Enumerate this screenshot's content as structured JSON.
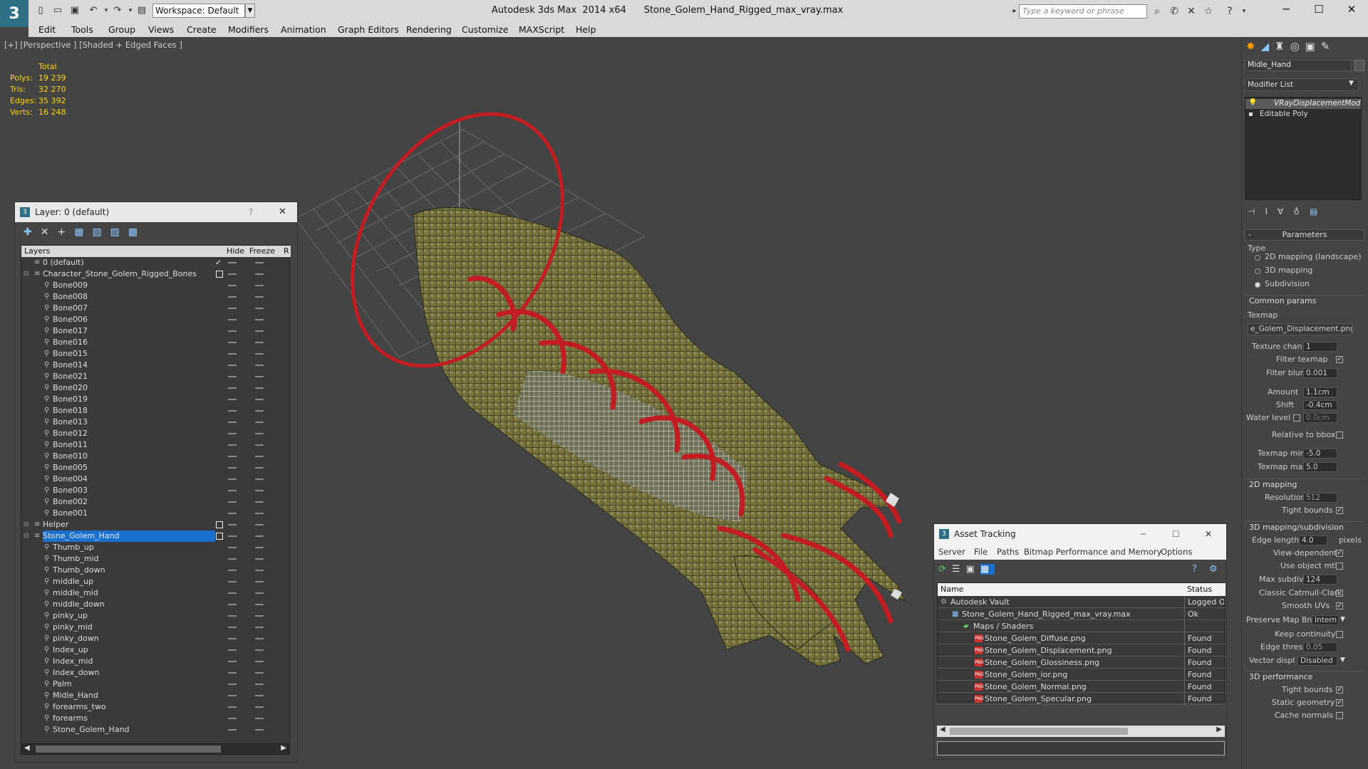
{
  "title_bar": {
    "app_title": "Autodesk 3ds Max  2014 x64",
    "file_name": "Stone_Golem_Hand_Rigged_max_vray.max",
    "workspace": "Workspace: Default",
    "search_placeholder": "Type a keyword or phrase"
  },
  "menu": [
    "Edit",
    "Tools",
    "Group",
    "Views",
    "Create",
    "Modifiers",
    "Animation",
    "Graph Editors",
    "Rendering",
    "Customize",
    "MAXScript",
    "Help"
  ],
  "viewport": {
    "label": "[+] [Perspective ] [Shaded + Edged Faces ]",
    "stats_header": "Total",
    "stats": [
      {
        "label": "Polys:",
        "value": "19 239"
      },
      {
        "label": "Tris:",
        "value": "32 270"
      },
      {
        "label": "Edges:",
        "value": "35 392"
      },
      {
        "label": "Verts:",
        "value": "16 248"
      }
    ]
  },
  "layer_panel": {
    "title": "Layer: 0 (default)",
    "help": "?",
    "close": "✕",
    "columns": {
      "layers": "Layers",
      "hide": "Hide",
      "freeze": "Freeze",
      "render": "R"
    },
    "rows": [
      {
        "name": "0 (default)",
        "level": 0,
        "kind": "layer"
      },
      {
        "name": "Character_Stone_Golem_Rigged_Bones",
        "level": 0,
        "kind": "layer"
      },
      {
        "name": "Bone009",
        "level": 1,
        "kind": "object"
      },
      {
        "name": "Bone008",
        "level": 1,
        "kind": "object"
      },
      {
        "name": "Bone007",
        "level": 1,
        "kind": "object"
      },
      {
        "name": "Bone006",
        "level": 1,
        "kind": "object"
      },
      {
        "name": "Bone017",
        "level": 1,
        "kind": "object"
      },
      {
        "name": "Bone016",
        "level": 1,
        "kind": "object"
      },
      {
        "name": "Bone015",
        "level": 1,
        "kind": "object"
      },
      {
        "name": "Bone014",
        "level": 1,
        "kind": "object"
      },
      {
        "name": "Bone021",
        "level": 1,
        "kind": "object"
      },
      {
        "name": "Bone020",
        "level": 1,
        "kind": "object"
      },
      {
        "name": "Bone019",
        "level": 1,
        "kind": "object"
      },
      {
        "name": "Bone018",
        "level": 1,
        "kind": "object"
      },
      {
        "name": "Bone013",
        "level": 1,
        "kind": "object"
      },
      {
        "name": "Bone012",
        "level": 1,
        "kind": "object"
      },
      {
        "name": "Bone011",
        "level": 1,
        "kind": "object"
      },
      {
        "name": "Bone010",
        "level": 1,
        "kind": "object"
      },
      {
        "name": "Bone005",
        "level": 1,
        "kind": "object"
      },
      {
        "name": "Bone004",
        "level": 1,
        "kind": "object"
      },
      {
        "name": "Bone003",
        "level": 1,
        "kind": "object"
      },
      {
        "name": "Bone002",
        "level": 1,
        "kind": "object"
      },
      {
        "name": "Bone001",
        "level": 1,
        "kind": "object"
      },
      {
        "name": "Helper",
        "level": 0,
        "kind": "layer"
      },
      {
        "name": "Stone_Golem_Hand",
        "level": 0,
        "kind": "layer",
        "selected": true
      },
      {
        "name": "Thumb_up",
        "level": 1,
        "kind": "object"
      },
      {
        "name": "Thumb_mid",
        "level": 1,
        "kind": "object"
      },
      {
        "name": "Thumb_down",
        "level": 1,
        "kind": "object"
      },
      {
        "name": "middle_up",
        "level": 1,
        "kind": "object"
      },
      {
        "name": "middle_mid",
        "level": 1,
        "kind": "object"
      },
      {
        "name": "middle_down",
        "level": 1,
        "kind": "object"
      },
      {
        "name": "pinky_up",
        "level": 1,
        "kind": "object"
      },
      {
        "name": "pinky_mid",
        "level": 1,
        "kind": "object"
      },
      {
        "name": "pinky_down",
        "level": 1,
        "kind": "object"
      },
      {
        "name": "Index_up",
        "level": 1,
        "kind": "object"
      },
      {
        "name": "Index_mid",
        "level": 1,
        "kind": "object"
      },
      {
        "name": "Index_down",
        "level": 1,
        "kind": "object"
      },
      {
        "name": "Palm",
        "level": 1,
        "kind": "object"
      },
      {
        "name": "Midle_Hand",
        "level": 1,
        "kind": "object"
      },
      {
        "name": "forearms_two",
        "level": 1,
        "kind": "object"
      },
      {
        "name": "forearms",
        "level": 1,
        "kind": "object"
      },
      {
        "name": "Stone_Golem_Hand",
        "level": 1,
        "kind": "object"
      }
    ]
  },
  "asset_tracking": {
    "title": "Asset Tracking",
    "menu": [
      "Server",
      "File",
      "Paths",
      "Bitmap Performance and Memory",
      "Options"
    ],
    "columns": {
      "name": "Name",
      "status": "Status"
    },
    "rows": [
      {
        "name": "Autodesk Vault",
        "status": "Logged O",
        "level": 0
      },
      {
        "name": "Stone_Golem_Hand_Rigged_max_vray.max",
        "status": "Ok",
        "level": 1
      },
      {
        "name": "Maps / Shaders",
        "status": "",
        "level": 2
      },
      {
        "name": "Stone_Golem_Diffuse.png",
        "status": "Found",
        "level": 3
      },
      {
        "name": "Stone_Golem_Displacement.png",
        "status": "Found",
        "level": 3
      },
      {
        "name": "Stone_Golem_Glossiness.png",
        "status": "Found",
        "level": 3
      },
      {
        "name": "Stone_Golem_ior.png",
        "status": "Found",
        "level": 3
      },
      {
        "name": "Stone_Golem_Normal.png",
        "status": "Found",
        "level": 3
      },
      {
        "name": "Stone_Golem_Specular.png",
        "status": "Found",
        "level": 3
      }
    ]
  },
  "command_panel": {
    "object_name": "Midle_Hand",
    "modifier_list": "Modifier List",
    "stack": [
      "VRayDisplacementMod",
      "Editable Poly"
    ],
    "parameters": "Parameters",
    "type_label": "Type",
    "type_options": [
      "2D mapping (landscape)",
      "3D mapping",
      "Subdivision"
    ],
    "type_selected": 2,
    "common_params": "Common params",
    "texmap_label": "Texmap",
    "texmap_value": "e_Golem_Displacement.png)",
    "texture_chan_label": "Texture chan",
    "texture_chan": "1",
    "filter_texmap": "Filter texmap",
    "filter_blur_label": "Filter blur",
    "filter_blur": "0.001",
    "amount_label": "Amount",
    "amount": "1.1cm",
    "shift_label": "Shift",
    "shift": "-0.4cm",
    "water_level_label": "Water level",
    "water_level": "0.0cm",
    "relative_bbox": "Relative to bbox",
    "texmap_min_label": "Texmap min",
    "texmap_min": "-5.0",
    "texmap_max_label": "Texmap max",
    "texmap_max": "5.0",
    "mapping_2d": "2D mapping",
    "resolution_label": "Resolution",
    "resolution": "512",
    "tight_bounds": "Tight bounds",
    "mapping_3d": "3D mapping/subdivision",
    "edge_length_label": "Edge length",
    "edge_length": "4.0",
    "pixels": "pixels",
    "view_dependent": "View-dependent",
    "use_object_mtl": "Use object mtl",
    "max_subdivs_label": "Max subdivs",
    "max_subdivs": "124",
    "classic_cc": "Classic Catmull-Clark",
    "smooth_uvs": "Smooth UVs",
    "preserve_map_label": "Preserve Map Bnd",
    "preserve_map": "Intern",
    "keep_continuity": "Keep continuity",
    "edge_thresh_label": "Edge thresh",
    "edge_thresh": "0.05",
    "vector_displ_label": "Vector displ",
    "vector_displ": "Disabled",
    "perf_3d": "3D performance",
    "tight_bounds_2": "Tight bounds",
    "static_geometry": "Static geometry",
    "cache_normals": "Cache normals"
  }
}
